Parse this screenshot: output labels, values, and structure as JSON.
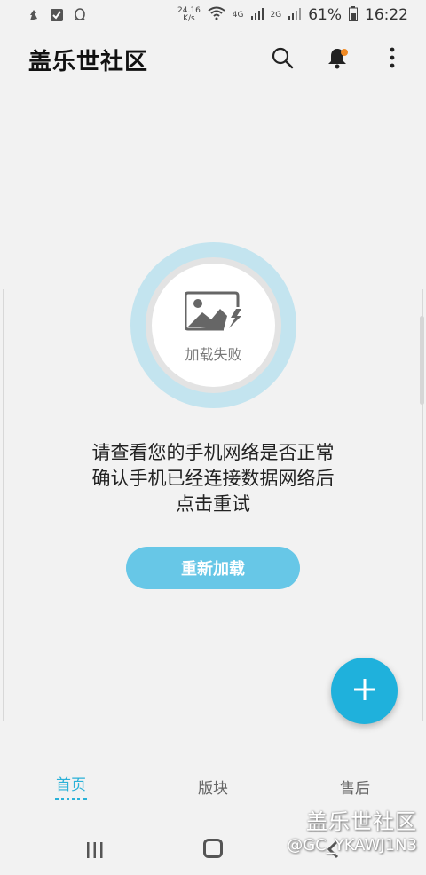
{
  "status_bar": {
    "net_speed_value": "24.16",
    "net_speed_unit": "K/s",
    "network_badge_1": "4G",
    "network_badge_2": "2G",
    "battery": "61%",
    "time": "16:22"
  },
  "header": {
    "title": "盖乐世社区",
    "icons": [
      "search-icon",
      "bell-icon",
      "more-vertical-icon"
    ],
    "notification_dot_color": "#f08a24"
  },
  "load_error": {
    "image_label": "加载失败",
    "message_lines": [
      "请查看您的手机网络是否正常",
      "确认手机已经连接数据网络后",
      "点击重试"
    ],
    "reload_button": "重新加载"
  },
  "fab": {
    "icon": "plus-icon"
  },
  "tabs": [
    {
      "label": "首页",
      "active": true
    },
    {
      "label": "版块",
      "active": false
    },
    {
      "label": "售后",
      "active": false
    }
  ],
  "watermark": {
    "title": "盖乐世社区",
    "user": "@GC_YKAWJ1N3"
  },
  "colors": {
    "accent": "#2ab1d8",
    "button": "#67c7e7",
    "fab": "#1fb1dc",
    "ring": "#c3e4ef"
  }
}
